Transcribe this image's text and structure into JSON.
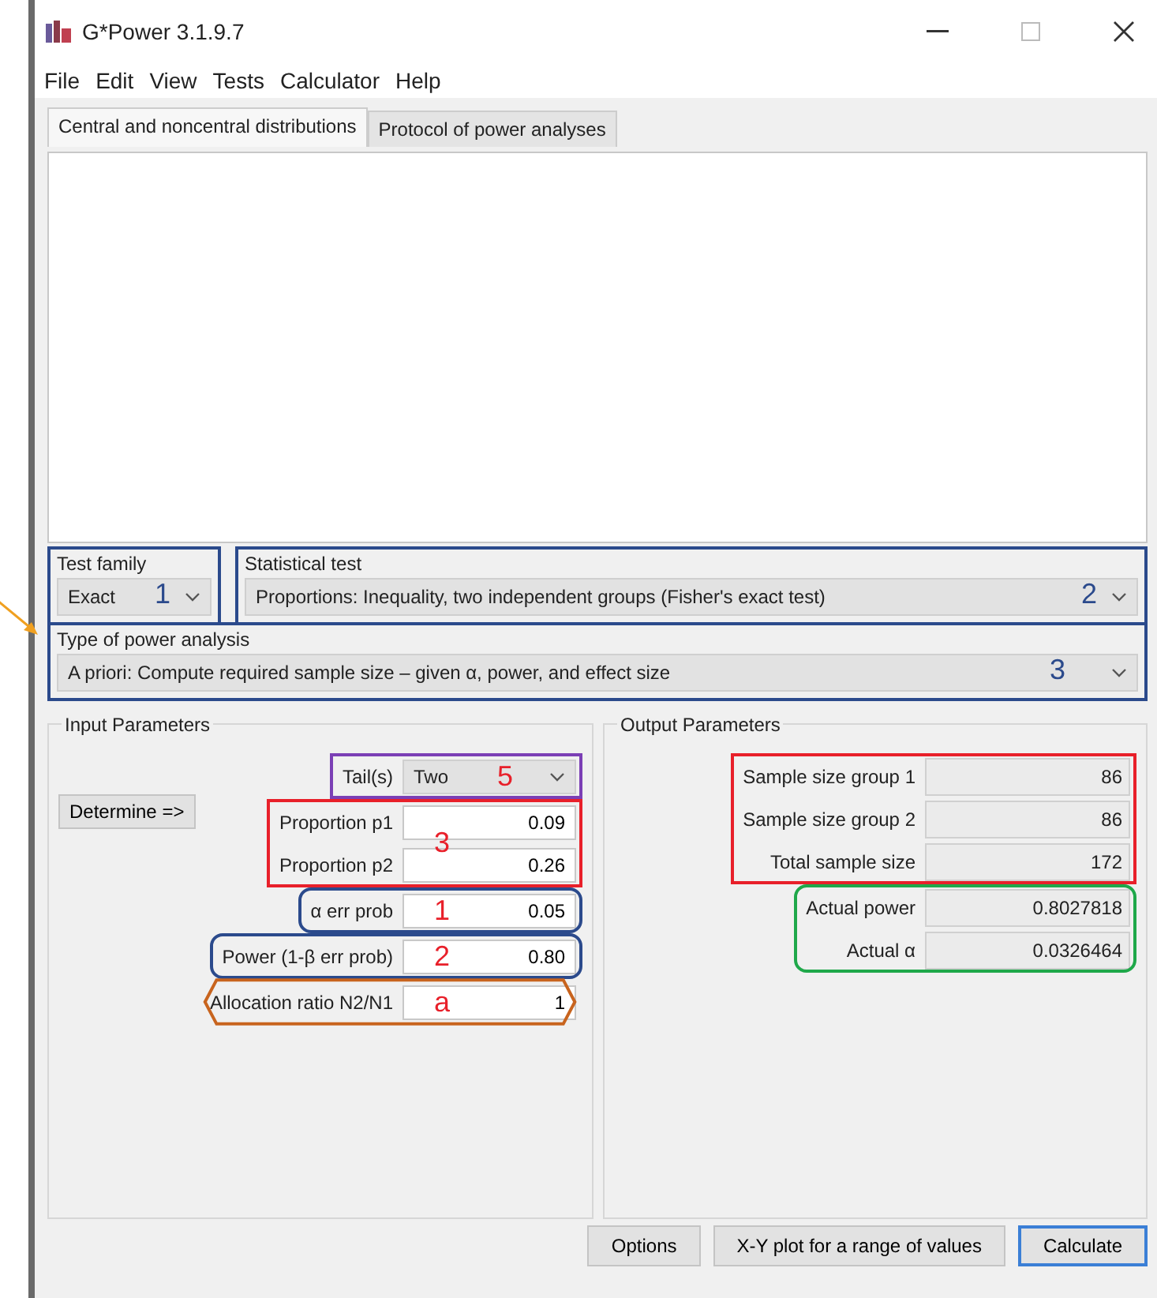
{
  "window": {
    "title": "G*Power 3.1.9.7"
  },
  "menu": [
    "File",
    "Edit",
    "View",
    "Tests",
    "Calculator",
    "Help"
  ],
  "tabs": [
    {
      "label": "Central and noncentral distributions",
      "selected": true
    },
    {
      "label": "Protocol of power analyses",
      "selected": false
    }
  ],
  "test_family": {
    "label": "Test family",
    "value": "Exact",
    "annotation": {
      "color": "#2b4a8c",
      "number": {
        "label": "1",
        "color": "#2b4a8c"
      }
    }
  },
  "statistical_test": {
    "label": "Statistical test",
    "value": "Proportions: Inequality, two independent groups (Fisher's exact test)",
    "annotation": {
      "color": "#2b4a8c",
      "number": {
        "label": "2",
        "color": "#2b4a8c"
      }
    }
  },
  "type_of_power_analysis": {
    "label": "Type of power analysis",
    "value": "A priori: Compute required sample size – given α, power, and effect size",
    "annotation": {
      "color": "#2b4a8c",
      "number": {
        "label": "3",
        "color": "#2b4a8c"
      }
    }
  },
  "input_parameters": {
    "title": "Input Parameters",
    "determine_button": "Determine =>",
    "groups": [
      {
        "annotation": {
          "kind": "box",
          "color": "#7b3fb5",
          "number": {
            "label": "5",
            "color": "#e8202a"
          }
        },
        "rows": [
          {
            "kind": "dropdown",
            "label": "Tail(s)",
            "value": "Two"
          }
        ]
      },
      {
        "annotation": {
          "kind": "box",
          "color": "#e8202a",
          "number": {
            "label": "3",
            "color": "#e8202a"
          }
        },
        "rows": [
          {
            "kind": "field",
            "label": "Proportion p1",
            "value": "0.09"
          },
          {
            "kind": "field",
            "label": "Proportion p2",
            "value": "0.26"
          }
        ]
      },
      {
        "annotation": {
          "kind": "rounded",
          "color": "#2b4a8c",
          "number": {
            "label": "1",
            "color": "#e8202a"
          }
        },
        "rows": [
          {
            "kind": "field",
            "label": "α err prob",
            "value": "0.05"
          }
        ]
      },
      {
        "annotation": {
          "kind": "rounded",
          "color": "#2b4a8c",
          "number": {
            "label": "2",
            "color": "#e8202a"
          }
        },
        "rows": [
          {
            "kind": "field",
            "label": "Power (1-β err prob)",
            "value": "0.80"
          }
        ]
      },
      {
        "annotation": {
          "kind": "hexagon",
          "color": "#c8641e",
          "number": {
            "label": "a",
            "color": "#e8202a"
          }
        },
        "rows": [
          {
            "kind": "field",
            "label": "Allocation ratio N2/N1",
            "value": "1"
          }
        ]
      }
    ]
  },
  "output_parameters": {
    "title": "Output Parameters",
    "groups": [
      {
        "annotation": {
          "kind": "box",
          "color": "#e8202a"
        },
        "rows": [
          {
            "label": "Sample size group 1",
            "value": "86"
          },
          {
            "label": "Sample size group 2",
            "value": "86"
          },
          {
            "label": "Total sample size",
            "value": "172"
          }
        ]
      },
      {
        "annotation": {
          "kind": "rounded",
          "color": "#1fa84a"
        },
        "rows": [
          {
            "label": "Actual power",
            "value": "0.8027818"
          },
          {
            "label": "Actual α",
            "value": "0.0326464"
          }
        ]
      }
    ]
  },
  "buttons": [
    {
      "label": "Options",
      "default": false
    },
    {
      "label": "X-Y plot for a range of values",
      "default": false
    },
    {
      "label": "Calculate",
      "default": true
    }
  ]
}
